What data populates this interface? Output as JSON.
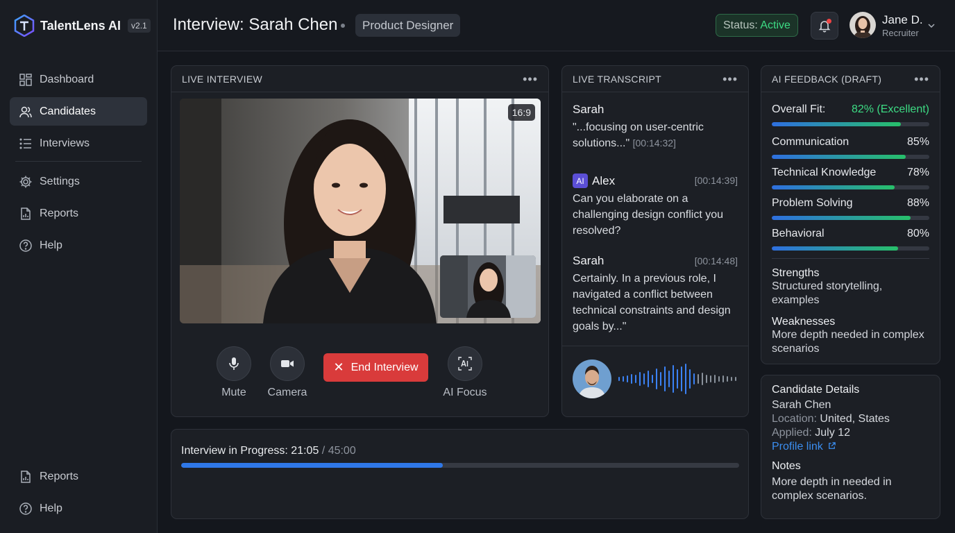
{
  "app": {
    "name": "TalentLens AI",
    "version": "v2.1"
  },
  "sidebar": {
    "items": [
      {
        "label": "Dashboard",
        "icon": "grid-icon"
      },
      {
        "label": "Candidates",
        "icon": "users-icon",
        "active": true
      },
      {
        "label": "Interviews",
        "icon": "list-icon"
      },
      {
        "label": "Settings",
        "icon": "gear-icon"
      },
      {
        "label": "Reports",
        "icon": "report-icon"
      },
      {
        "label": "Help",
        "icon": "help-icon"
      }
    ],
    "bottom": [
      {
        "label": "Reports",
        "icon": "report-icon"
      },
      {
        "label": "Help",
        "icon": "help-icon"
      }
    ]
  },
  "header": {
    "title": "Interview: Sarah Chen",
    "role": "Product Designer",
    "status_label": "Status:",
    "status_value": "Active",
    "user_name": "Jane D.",
    "user_role": "Recruiter"
  },
  "live": {
    "title": "LIVE INTERVIEW",
    "ratio": "16:9",
    "controls": {
      "mute": "Mute",
      "camera": "Camera",
      "end": "End Interview",
      "ai_focus": "AI Focus"
    }
  },
  "transcript": {
    "title": "LIVE TRANSCRIPT",
    "entries": [
      {
        "speaker": "Sarah",
        "text": "\"...focusing on user-centric solutions...\"",
        "time": "[00:14:32]"
      },
      {
        "speaker": "Alex",
        "ai_badge": "AI",
        "text": "Can you elaborate on a challenging design conflict you resolved?",
        "time": "[00:14:39]"
      },
      {
        "speaker": "Sarah",
        "text": "Certainly. In a previous role, I navigated a conflict between technical constraints and design goals by...\"",
        "time": "[00:14:48]"
      }
    ]
  },
  "feedback": {
    "title": "AI FEEDBACK (DRAFT)",
    "overall_label": "Overall Fit:",
    "overall_value": "82% (Excellent)",
    "overall_score": 0.82,
    "metrics": [
      {
        "label": "Communication",
        "value": "85%",
        "score": 0.85
      },
      {
        "label": "Technical Knowledge",
        "value": "78%",
        "score": 0.78
      },
      {
        "label": "Problem Solving",
        "value": "88%",
        "score": 0.88
      },
      {
        "label": "Behavioral",
        "value": "80%",
        "score": 0.8
      }
    ],
    "strengths_label": "Strengths",
    "strengths_text": "Structured storytelling, examples",
    "weaknesses_label": "Weaknesses",
    "weaknesses_text": "More depth needed in complex scenarios"
  },
  "candidate": {
    "title": "Candidate Details",
    "name": "Sarah Chen",
    "location_label": "Location:",
    "location": "United, States",
    "applied_label": "Applied:",
    "applied": "July 12",
    "profile_link": "Profile link",
    "notes_label": "Notes",
    "notes_text": "More depth in needed in complex scenarios."
  },
  "progress": {
    "label": "Interview in Progress:",
    "elapsed": "21:05",
    "total": "/ 45:00",
    "fraction": 0.469
  },
  "colors": {
    "accent": "#2f78e8",
    "success": "#3ddc84",
    "danger": "#d93b3b",
    "ai": "#5b4fd6"
  }
}
